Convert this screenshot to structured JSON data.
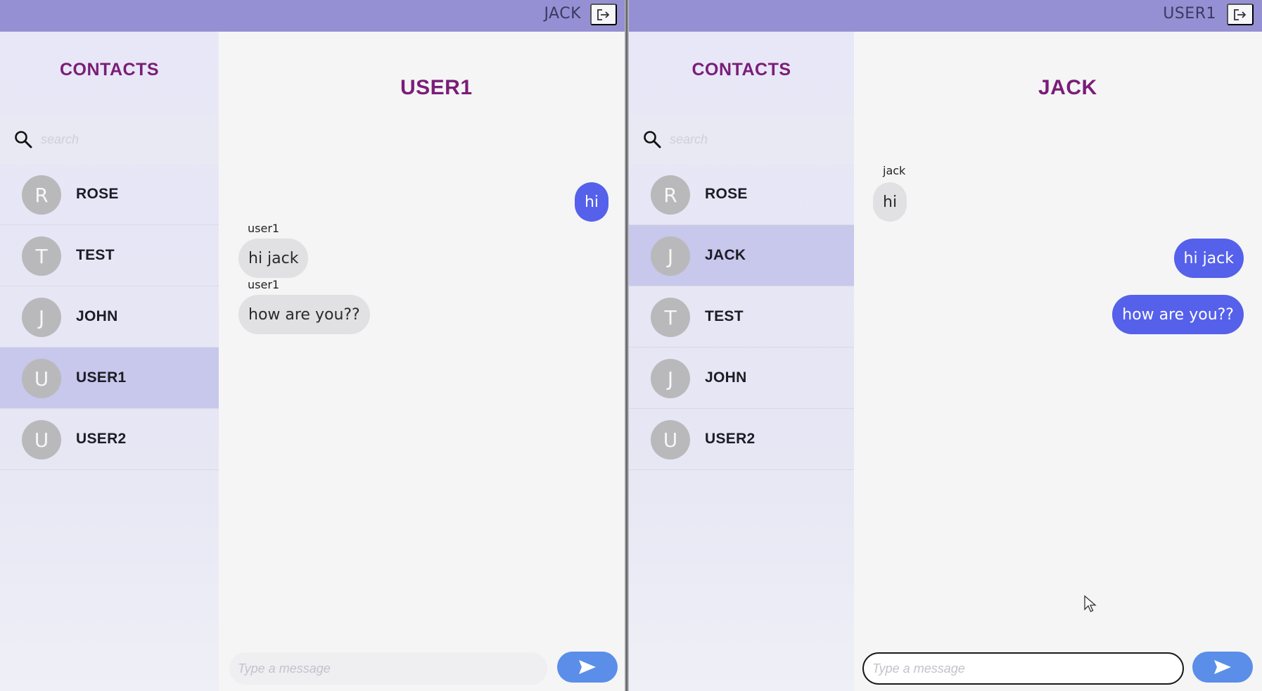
{
  "left_window": {
    "current_user": "JACK",
    "sidebar": {
      "title": "CONTACTS",
      "search_placeholder": "search",
      "contacts": [
        {
          "initial": "R",
          "name": "ROSE"
        },
        {
          "initial": "T",
          "name": "TEST"
        },
        {
          "initial": "J",
          "name": "JOHN"
        },
        {
          "initial": "U",
          "name": "USER1",
          "active": true
        },
        {
          "initial": "U",
          "name": "USER2"
        }
      ]
    },
    "chat": {
      "title": "USER1",
      "messages": [
        {
          "direction": "out",
          "text": "hi"
        },
        {
          "direction": "in",
          "sender": "user1",
          "text": "hi jack"
        },
        {
          "direction": "in",
          "sender": "user1",
          "text": "how are you??"
        }
      ],
      "input_placeholder": "Type a message"
    }
  },
  "right_window": {
    "current_user": "USER1",
    "sidebar": {
      "title": "CONTACTS",
      "search_placeholder": "search",
      "contacts": [
        {
          "initial": "R",
          "name": "ROSE"
        },
        {
          "initial": "J",
          "name": "JACK",
          "active": true
        },
        {
          "initial": "T",
          "name": "TEST"
        },
        {
          "initial": "J",
          "name": "JOHN"
        },
        {
          "initial": "U",
          "name": "USER2"
        }
      ]
    },
    "chat": {
      "title": "JACK",
      "messages": [
        {
          "direction": "in",
          "sender": "jack",
          "text": "hi"
        },
        {
          "direction": "out",
          "text": "hi jack"
        },
        {
          "direction": "out",
          "text": "how are you??"
        }
      ],
      "input_placeholder": "Type a message"
    }
  },
  "icons": {
    "logout": "logout-icon",
    "search": "search-icon",
    "send": "send-icon",
    "cursor": "mouse-cursor-icon"
  },
  "colors": {
    "topbar": "#9590d3",
    "accent_title": "#7a1d78",
    "outgoing_bubble": "#5561ea",
    "incoming_bubble": "#e1e1e3",
    "active_contact": "#c8c7ec",
    "send_button": "#5a8ee9"
  }
}
